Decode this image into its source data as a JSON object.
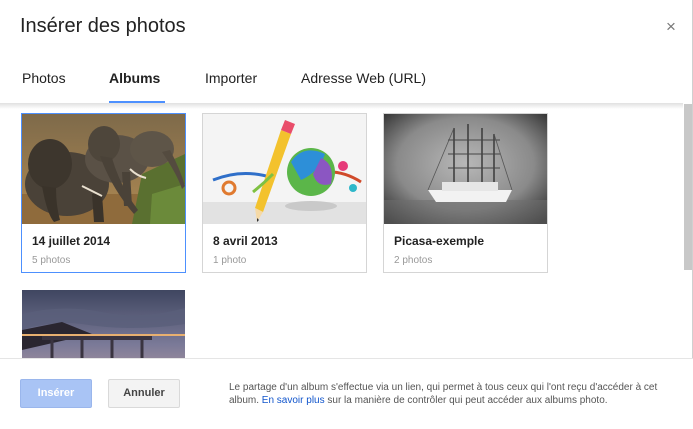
{
  "dialog": {
    "title": "Insérer des photos",
    "close_icon": "×"
  },
  "tabs": [
    {
      "label": "Photos",
      "active": false
    },
    {
      "label": "Albums",
      "active": true
    },
    {
      "label": "Importer",
      "active": false
    },
    {
      "label": "Adresse Web (URL)",
      "active": false
    }
  ],
  "albums": [
    {
      "title": "14 juillet 2014",
      "count": "5 photos",
      "selected": true,
      "image": "elephants"
    },
    {
      "title": "8 avril 2013",
      "count": "1 photo",
      "selected": false,
      "image": "pencil-illustration"
    },
    {
      "title": "Picasa-exemple",
      "count": "2 photos",
      "selected": false,
      "image": "sailing-ship"
    },
    {
      "title": "",
      "count": "",
      "selected": false,
      "image": "coastal-bridge"
    }
  ],
  "footer": {
    "insert_label": "Insérer",
    "cancel_label": "Annuler",
    "info_before_link": "Le partage d'un album s'effectue via un lien, qui permet à tous ceux qui l'ont reçu d'accéder à cet album. ",
    "info_link": "En savoir plus",
    "info_after_link": " sur la manière de contrôler qui peut accéder aux albums photo."
  },
  "colors": {
    "accent": "#4d90fe",
    "insert_button": "#a9c4f5",
    "link": "#1155cc"
  }
}
